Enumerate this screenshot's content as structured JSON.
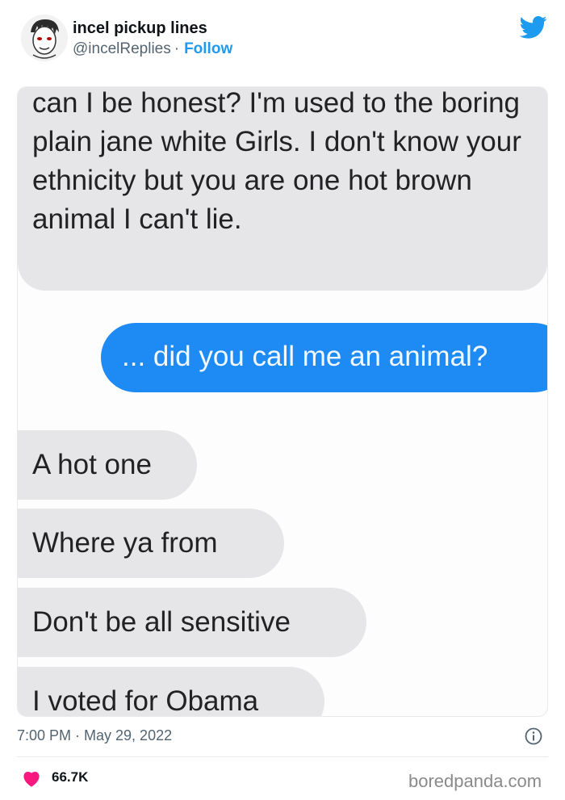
{
  "tweet": {
    "author": {
      "display_name": "incel pickup lines",
      "handle": "@incelReplies",
      "separator": "·",
      "follow_label": "Follow"
    },
    "platform_icon": "twitter-bird-icon",
    "accent_color": "#1d9bf0",
    "embedded_screenshot": {
      "messages": [
        {
          "side": "received",
          "text": "can I  be honest? I'm used to the boring plain jane white Girls. I don't know your ethnicity but you are one hot brown animal I can't lie."
        },
        {
          "side": "sent",
          "text": "... did you call me an animal?"
        },
        {
          "side": "received",
          "text": "A hot one"
        },
        {
          "side": "received",
          "text": "Where  ya from"
        },
        {
          "side": "received",
          "text": "Don't be all sensitive"
        },
        {
          "side": "received",
          "text": "I voted for Obama"
        }
      ],
      "sent_bubble_color": "#1e8bf5",
      "received_bubble_color": "#e6e6e9"
    },
    "timestamp": "7:00 PM · May 29, 2022",
    "likes": "66.7K",
    "heart_color": "#f91880"
  },
  "watermark": "boredpanda.com"
}
